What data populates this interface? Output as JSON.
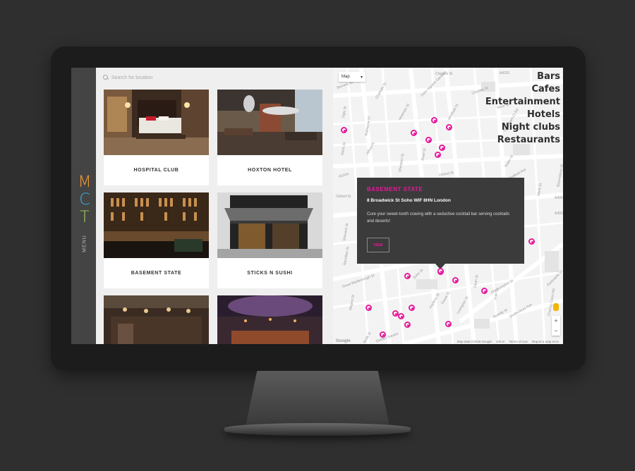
{
  "sidebar": {
    "logo_letters": [
      "M",
      "C",
      "T"
    ],
    "logo_colors": [
      "#f29b38",
      "#36b6e0",
      "#a3d65c"
    ],
    "menu_label": "MENU"
  },
  "search": {
    "placeholder": "Search for location"
  },
  "cards": [
    {
      "name": "HOSPITAL CLUB"
    },
    {
      "name": "HOXTON HOTEL"
    },
    {
      "name": "BASEMENT STATE"
    },
    {
      "name": "STICKS N SUSHI"
    },
    {
      "name": ""
    },
    {
      "name": ""
    }
  ],
  "map": {
    "type_label": "Map",
    "categories": [
      "Bars",
      "Cafes",
      "Entertainment",
      "Hotels",
      "Night clubs",
      "Restaurants"
    ],
    "popup": {
      "title": "BASEMENT STATE",
      "address": "8 Broadwick St Soho WIF 8HN London",
      "description": "Cure your sweet-tooth craving with a seductive cocktail bar serving cocktails and deserts!",
      "button": "VIEW"
    },
    "zoom_in": "+",
    "zoom_out": "−",
    "footer": {
      "google": "Google",
      "data": "Map data ©2018 Google",
      "scale": "100 m",
      "terms": "Terms of Use",
      "report": "Report a map error"
    },
    "streets": [
      "Dean St",
      "Greek St",
      "Frith St",
      "Rupert St",
      "Oxford St",
      "Wardour St",
      "Regent St",
      "Old Compton St",
      "Charing Cross Rd",
      "Shaftesbury Ave",
      "Berwick St",
      "Poland St",
      "Great Marlborough St",
      "Romilly St",
      "Lexington St",
      "Hopkins St",
      "Broadwick St",
      "Golden Square",
      "Soho Square Gardens",
      "Chenies St",
      "Store St",
      "Tottenham Ct Rd",
      "Goodge St",
      "Great Portland St",
      "Riding House St",
      "Mortimer St",
      "Charlotte St",
      "Newman St",
      "Percy St",
      "Rathbone Pl",
      "Bedford Ave",
      "Denmark St",
      "Bloomsbury St",
      "Alfred Pl",
      "Whitfield St",
      "Wells St",
      "Bolsover St",
      "Foley St",
      "Eastcastle St",
      "Soho St",
      "Berners St",
      "Carlisle St",
      "Sheraton St",
      "Rose St",
      "Tower St",
      "Gerrard St",
      "Warwick St",
      "Kingly St",
      "Beak St",
      "Marshall St",
      "A40",
      "A4201",
      "A400",
      "A5204",
      "A4",
      "Gt Chapel St",
      "Ogle St",
      "Bolsover St",
      "Noel St",
      "Marlborough Ct",
      "Hanway St",
      "Winsley St",
      "Ramillies St",
      "Argyll St",
      "Ganton St",
      "Fouberts Pl",
      "Great Pulteney St"
    ]
  }
}
